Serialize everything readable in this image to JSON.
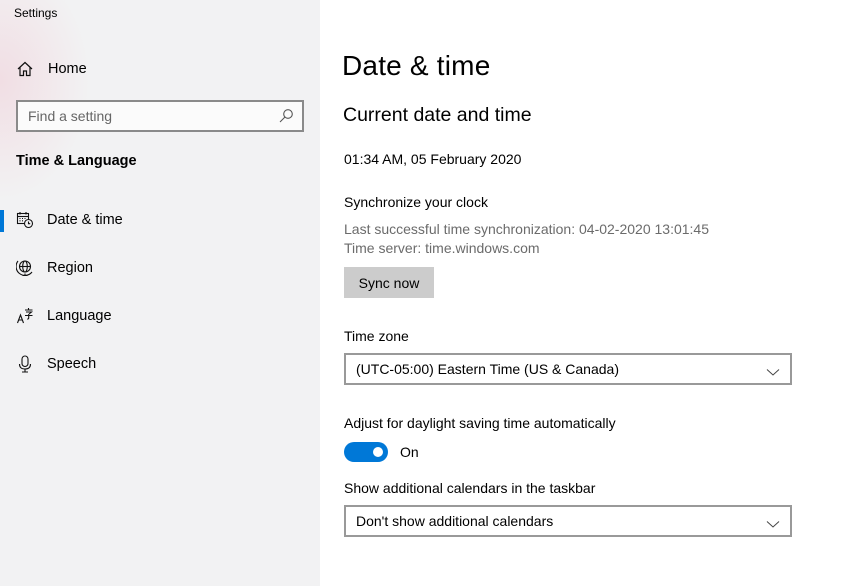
{
  "window": {
    "title": "Settings"
  },
  "sidebar": {
    "home": {
      "label": "Home",
      "icon": "home-icon"
    },
    "search": {
      "placeholder": "Find a setting",
      "value": "",
      "icon": "search-icon"
    },
    "section_title": "Time & Language",
    "items": [
      {
        "label": "Date & time",
        "icon": "calendar-clock-icon",
        "selected": true
      },
      {
        "label": "Region",
        "icon": "globe-icon",
        "selected": false
      },
      {
        "label": "Language",
        "icon": "language-icon",
        "selected": false
      },
      {
        "label": "Speech",
        "icon": "microphone-icon",
        "selected": false
      }
    ]
  },
  "main": {
    "page_title": "Date & time",
    "subtitle": "Current date and time",
    "current_datetime": "01:34 AM, 05 February 2020",
    "sync": {
      "heading": "Synchronize your clock",
      "last_sync": "Last successful time synchronization: 04-02-2020 13:01:45",
      "time_server": "Time server: time.windows.com",
      "button_label": "Sync now"
    },
    "time_zone": {
      "label": "Time zone",
      "selected": "(UTC-05:00) Eastern Time (US & Canada)"
    },
    "daylight_saving": {
      "label": "Adjust for daylight saving time automatically",
      "state_label": "On",
      "enabled": true
    },
    "additional_calendars": {
      "label": "Show additional calendars in the taskbar",
      "selected": "Don't show additional calendars"
    }
  },
  "colors": {
    "accent": "#0078d7",
    "button_bg": "#cccccc",
    "secondary_text": "#6b6b6b",
    "sidebar_bg": "#f2f2f3"
  }
}
